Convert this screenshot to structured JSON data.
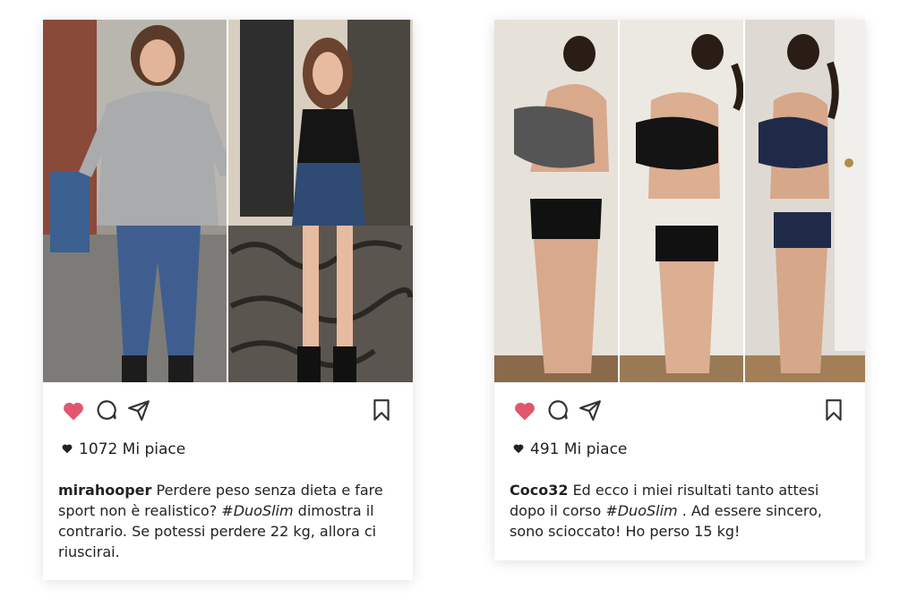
{
  "posts": [
    {
      "username": "mirahooper",
      "caption_a": " Perdere peso senza dieta e fare sport non è realistico? ",
      "hashtag": "#DuoSlim",
      "caption_b": " dimostra il contrario. Se potessi perdere 22 kg, allora ci riuscirai.",
      "likes": "1072 Mi piace",
      "photo": "before-after-transformation-photo"
    },
    {
      "username": "Coco32",
      "caption_a": " Ed ecco i miei risultati tanto attesi dopo il corso ",
      "hashtag": "#DuoSlim",
      "caption_b": " . Ad essere sincero, sono scioccato! Ho perso 15 kg!",
      "likes": "491 Mi piace",
      "photo": "side-profile-progress-photos"
    }
  ],
  "icons": {
    "like": "heart-icon",
    "comment": "comment-icon",
    "share": "send-icon",
    "save": "bookmark-icon",
    "likes_marker": "small-heart-icon"
  },
  "colors": {
    "liked_heart": "#e0566f",
    "icon_stroke": "#333333"
  }
}
